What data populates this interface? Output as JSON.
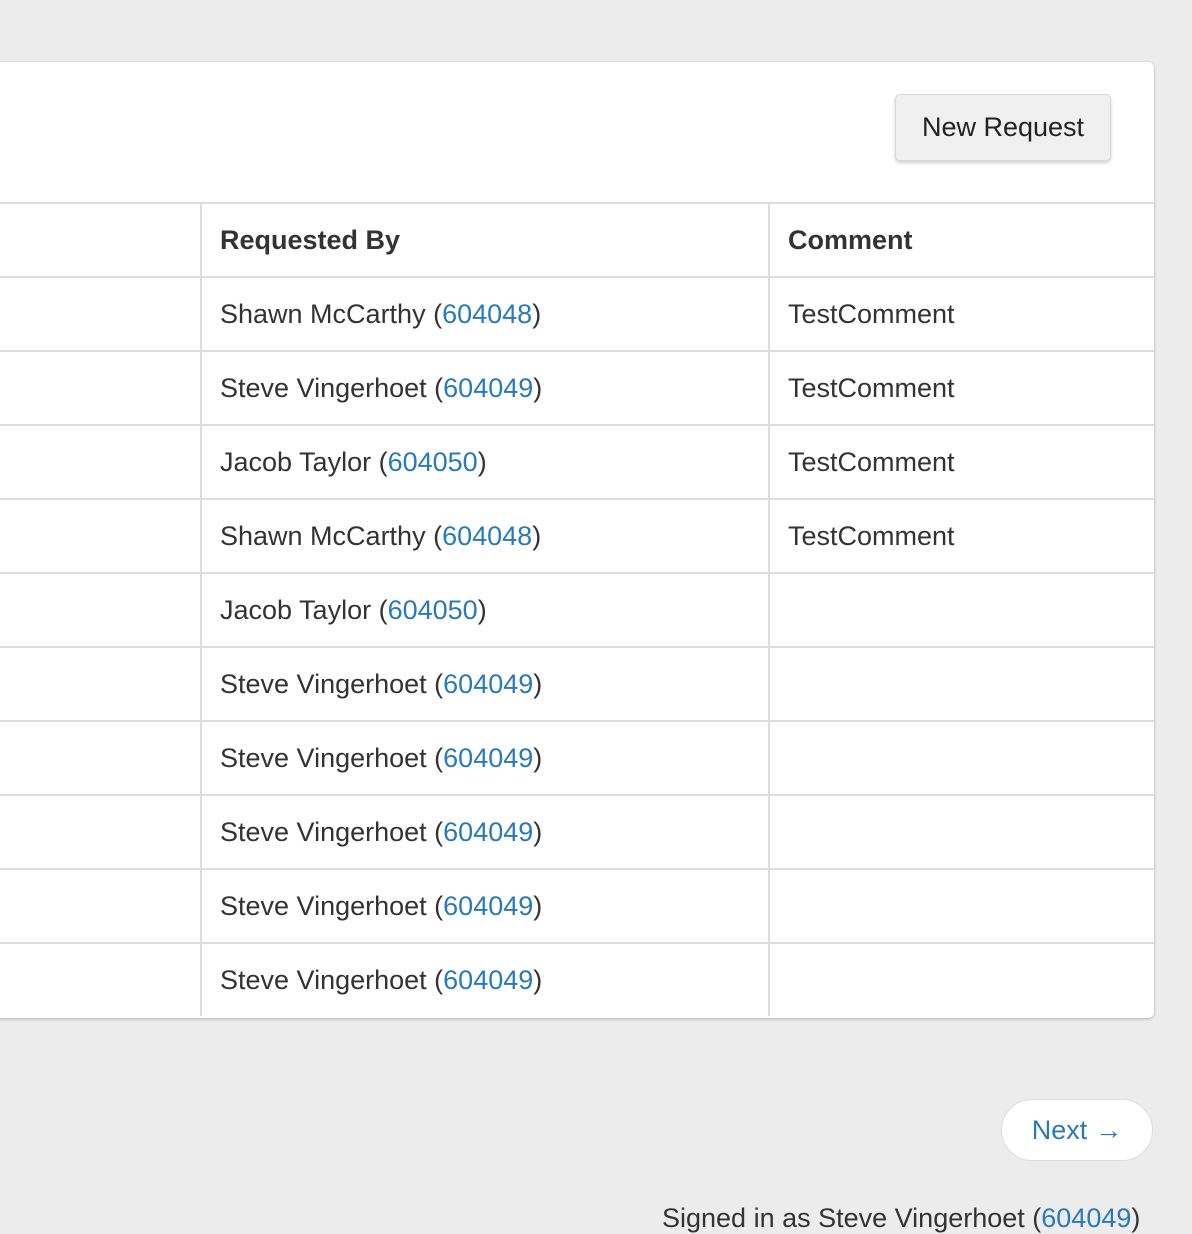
{
  "toolbar": {
    "new_request_label": "New Request"
  },
  "table": {
    "headers": [
      "",
      "Requested By",
      "Comment"
    ],
    "rows": [
      {
        "name": "Shawn McCarthy",
        "id": "604048",
        "comment": "TestComment"
      },
      {
        "name": "Steve Vingerhoet",
        "id": "604049",
        "comment": "TestComment"
      },
      {
        "name": "Jacob Taylor",
        "id": "604050",
        "comment": "TestComment"
      },
      {
        "name": "Shawn McCarthy",
        "id": "604048",
        "comment": "TestComment"
      },
      {
        "name": "Jacob Taylor",
        "id": "604050",
        "comment": ""
      },
      {
        "name": "Steve Vingerhoet",
        "id": "604049",
        "comment": ""
      },
      {
        "name": "Steve Vingerhoet",
        "id": "604049",
        "comment": ""
      },
      {
        "name": "Steve Vingerhoet",
        "id": "604049",
        "comment": ""
      },
      {
        "name": "Steve Vingerhoet",
        "id": "604049",
        "comment": ""
      },
      {
        "name": "Steve Vingerhoet",
        "id": "604049",
        "comment": ""
      }
    ]
  },
  "pagination": {
    "next_label": "Next",
    "next_arrow": "→"
  },
  "footer": {
    "signed_in_prefix": "Signed in as ",
    "signed_in_name": "Steve Vingerhoet",
    "signed_in_id": "604049"
  },
  "colors": {
    "link": "#2a7ab8",
    "background": "#ececec",
    "panel": "#ffffff"
  }
}
